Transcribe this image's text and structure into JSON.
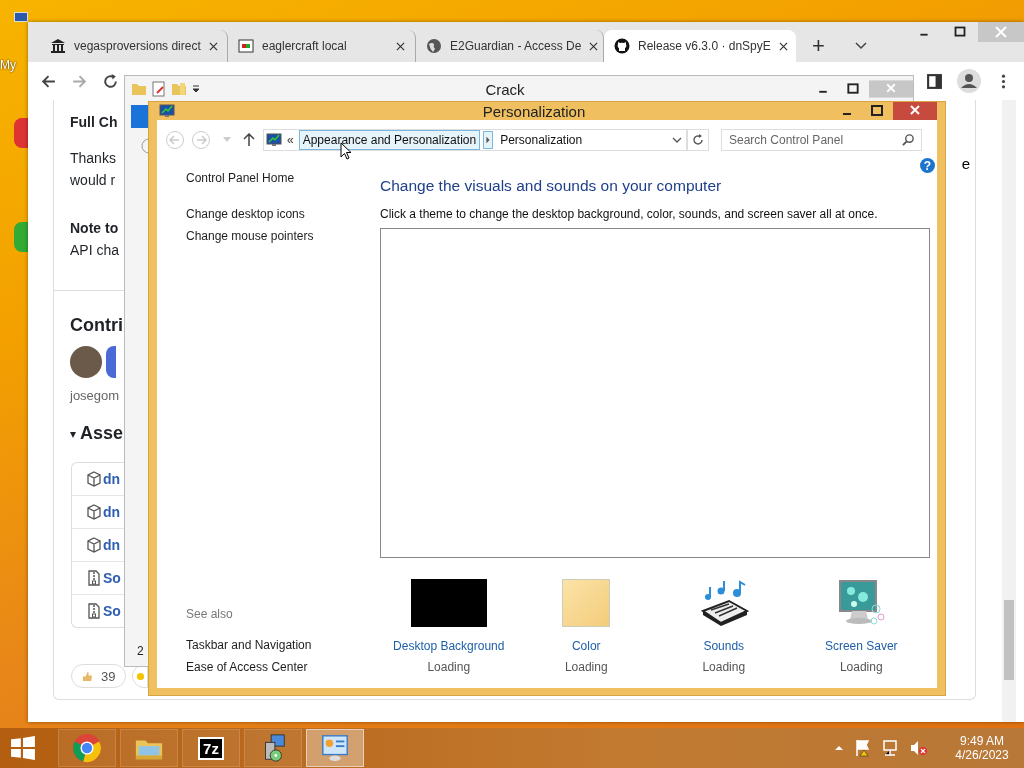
{
  "desktop": {
    "icon_label": "My"
  },
  "browser": {
    "tabs": [
      {
        "title": "vegasproversions direct",
        "kind": "building",
        "selected": false
      },
      {
        "title": "eaglercraft local",
        "kind": "app",
        "selected": false
      },
      {
        "title": "E2Guardian - Access De",
        "kind": "globe",
        "selected": false
      },
      {
        "title": "Release v6.3.0 · dnSpyE",
        "kind": "github",
        "selected": true
      }
    ],
    "new_tab": "+"
  },
  "page": {
    "release_heading": "Full Ch",
    "paragraph_lines": [
      "Thanks",
      "would r"
    ],
    "note_heading": "Note to",
    "note_line": "API cha",
    "side_fragment": "e",
    "contributors_heading": "Contri",
    "contributor_name": "josegom",
    "assets_toggle": "▾",
    "assets_heading": "Asse",
    "assets": [
      {
        "kind": "package",
        "name": "dn"
      },
      {
        "kind": "package",
        "name": "dn"
      },
      {
        "kind": "package",
        "name": "dn"
      },
      {
        "kind": "zip",
        "name": "So"
      },
      {
        "kind": "zip",
        "name": "So"
      }
    ],
    "reactions": [
      {
        "count": "39"
      }
    ]
  },
  "explorer": {
    "title": "Crack",
    "fragment": "2"
  },
  "personalization": {
    "title": "Personalization",
    "overflow": "«",
    "crumbs": [
      {
        "label": "Appearance and Personalization",
        "selected": true
      },
      {
        "label": "Personalization",
        "selected": false
      }
    ],
    "search": {
      "placeholder": "Search Control Panel"
    },
    "help": "?",
    "sidebar": [
      "Control Panel Home",
      "Change desktop icons",
      "Change mouse pointers"
    ],
    "see_also": {
      "title": "See also",
      "links": [
        "Taskbar and Navigation",
        "Ease of Access Center"
      ]
    },
    "heading": "Change the visuals and sounds on your computer",
    "description": "Click a theme to change the desktop background, color, sounds, and screen saver all at once.",
    "items": [
      {
        "kind": "background",
        "label": "Desktop Background",
        "status": "Loading"
      },
      {
        "kind": "color",
        "label": "Color",
        "status": "Loading"
      },
      {
        "kind": "sounds",
        "label": "Sounds",
        "status": "Loading"
      },
      {
        "kind": "screensaver",
        "label": "Screen Saver",
        "status": "Loading"
      }
    ]
  },
  "taskbar": {
    "apps": [
      {
        "kind": "chrome",
        "selected": false
      },
      {
        "kind": "explorer",
        "selected": false
      },
      {
        "kind": "archiver",
        "label": "7z",
        "selected": false
      },
      {
        "kind": "installer",
        "selected": false
      },
      {
        "kind": "control-panel",
        "selected": true
      }
    ],
    "time": "9:49 AM",
    "date": "4/26/2023"
  }
}
